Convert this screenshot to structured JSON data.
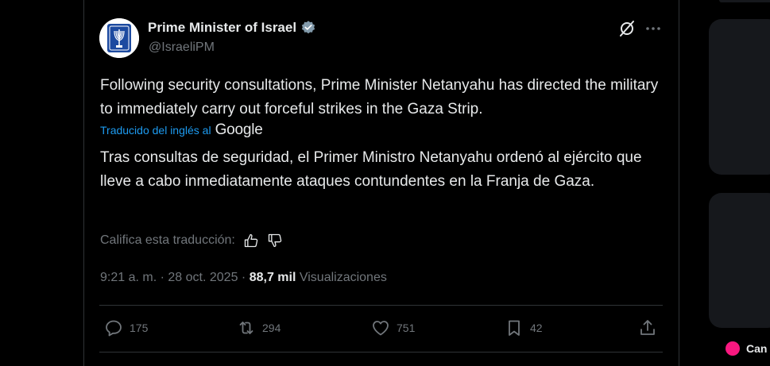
{
  "author": {
    "name": "Prime Minister of Israel",
    "handle": "@IsraeliPM"
  },
  "tweet": {
    "text": "Following security consultations, Prime Minister Netanyahu has directed the military to immediately carry out forceful strikes in the Gaza Strip.",
    "translated_label": "Traducido del inglés al",
    "translator": "Google",
    "translation": "Tras consultas de seguridad, el Primer Ministro Netanyahu ordenó al ejército que lleve a cabo inmediatamente ataques contundentes en la Franja de Gaza.",
    "rate_label": "Califica esta traducción:",
    "time": "9:21 a. m.",
    "separator": "·",
    "date": "28 oct. 2025",
    "views_count": "88,7 mil",
    "views_label": "Visualizaciones"
  },
  "actions": {
    "replies": "175",
    "reposts": "294",
    "likes": "751",
    "bookmarks": "42"
  },
  "right_panel": {
    "badge_text": "Can"
  },
  "colors": {
    "background": "#000000",
    "text": "#e7e9ea",
    "muted": "#71767b",
    "accent": "#1d9bf0",
    "border": "#2f3336"
  },
  "icons": [
    "verified-badge-icon",
    "grok-icon",
    "more-icon",
    "thumbs-up-icon",
    "thumbs-down-icon",
    "reply-icon",
    "repost-icon",
    "like-icon",
    "bookmark-icon",
    "share-icon"
  ]
}
